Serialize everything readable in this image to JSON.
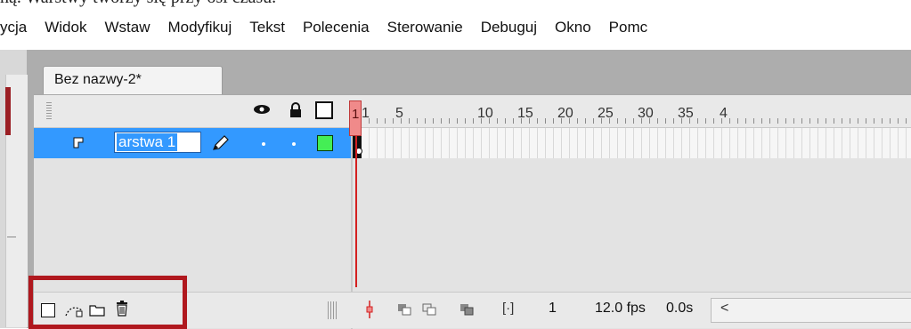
{
  "caption": "ną. Warstwy tworzy się przy osi czasu.",
  "menu": [
    "ycja",
    "Widok",
    "Wstaw",
    "Modyfikuj",
    "Tekst",
    "Polecenia",
    "Sterowanie",
    "Debuguj",
    "Okno",
    "Pomc"
  ],
  "document_tab": "Bez nazwy-2*",
  "ruler_labels": [
    "1",
    "5",
    "10",
    "15",
    "20",
    "25",
    "30",
    "35",
    "4"
  ],
  "layer": {
    "name": "arstwa 1",
    "color": "#44ee55"
  },
  "status": {
    "current_frame": "1",
    "frame_rate": "12.0 fps",
    "elapsed": "0.0s",
    "scroll_left": "<"
  },
  "colors": {
    "selection": "#3399ff",
    "playhead": "#d42020",
    "highlight": "#b0181e"
  }
}
